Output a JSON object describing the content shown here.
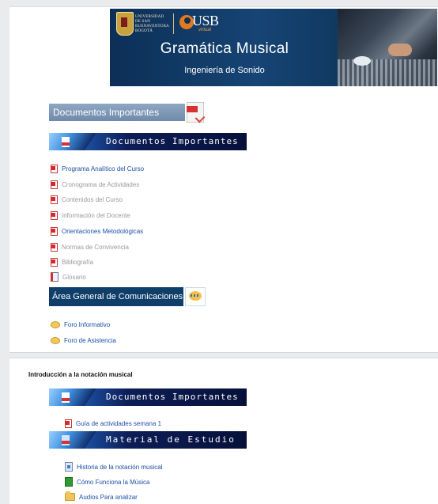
{
  "banner": {
    "university_text": "UNIVERSIDAD DE SAN BUENAVENTURA BOGOTÁ",
    "logo_text": "USB",
    "logo_sub": "virtual",
    "title": "Gramática Musical",
    "subtitle": "Ingeniería de Sonido"
  },
  "section0": {
    "doc_header": "Documentos Importantes",
    "doc_banner": "Documentos Importantes",
    "documents": [
      {
        "label": "Programa Analítico del Curso",
        "style": "link"
      },
      {
        "label": "Cronograma de Actividades",
        "style": "dim"
      },
      {
        "label": "Contenidos del Curso",
        "style": "dim"
      },
      {
        "label": "Información del Docente",
        "style": "dim"
      },
      {
        "label": "Orientaciones Metodológicas",
        "style": "link"
      },
      {
        "label": "Normas de Convivencia",
        "style": "dim"
      },
      {
        "label": "Bibliografía",
        "style": "dim"
      },
      {
        "label": "Glosario",
        "style": "dim"
      }
    ],
    "comms_header": "Área General de Comunicaciones",
    "forums": [
      "Foro Informativo",
      "Foro de Asistencia"
    ]
  },
  "section1": {
    "title": "Introducción a la notación musical",
    "doc_banner": "Documentos Importantes",
    "documents": [
      "Guía de actividades semana 1"
    ],
    "study_banner": "Material de Estudio",
    "materials": [
      "Historia de la notación musical",
      "Cómo Funciona la Música",
      "Audios Para analizar"
    ]
  },
  "colors": {
    "link": "#1d4fa6",
    "dim_text": "#9a9a9a",
    "banner_blue": "#0f3e6a",
    "pdf_red": "#d32b2b"
  }
}
